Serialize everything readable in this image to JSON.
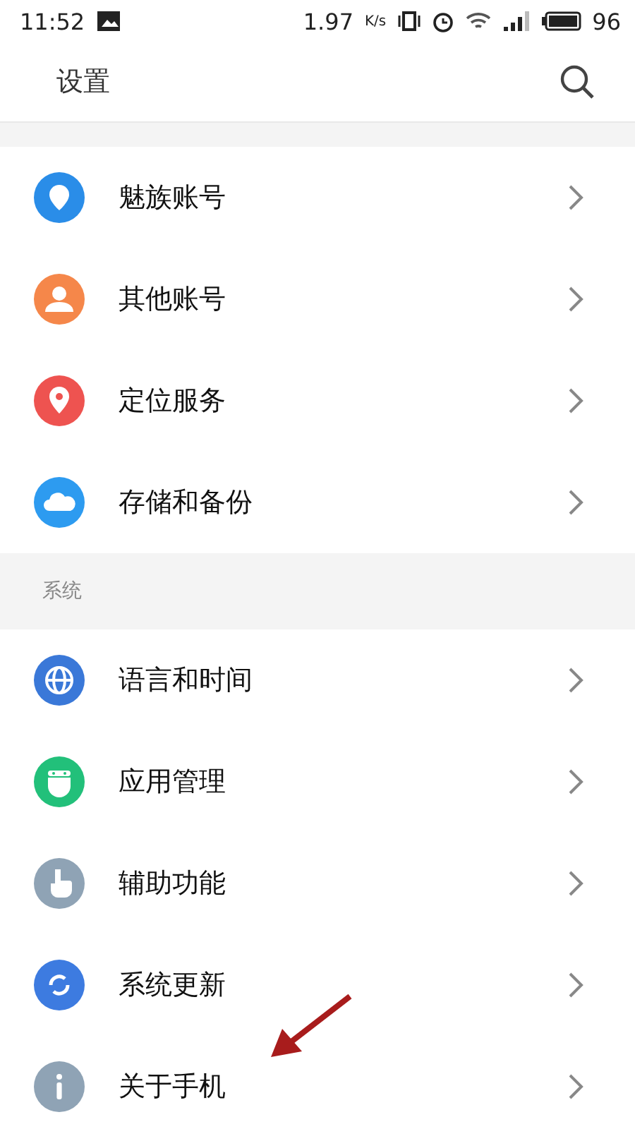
{
  "status_bar": {
    "time": "11:52",
    "speed": "1.97",
    "speed_unit": "K/s",
    "battery": "96"
  },
  "header": {
    "title": "设置"
  },
  "sections": [
    {
      "items": [
        {
          "label": "魅族账号",
          "color": "#2a8de8"
        },
        {
          "label": "其他账号",
          "color": "#f5874a"
        },
        {
          "label": "定位服务",
          "color": "#ee5350"
        },
        {
          "label": "存储和备份",
          "color": "#2d9bf0"
        }
      ]
    },
    {
      "title": "系统",
      "items": [
        {
          "label": "语言和时间",
          "color": "#3a78d8"
        },
        {
          "label": "应用管理",
          "color": "#22c07a"
        },
        {
          "label": "辅助功能",
          "color": "#8fa3b5"
        },
        {
          "label": "系统更新",
          "color": "#3d7be0"
        },
        {
          "label": "关于手机",
          "color": "#8fa3b5"
        }
      ]
    }
  ]
}
